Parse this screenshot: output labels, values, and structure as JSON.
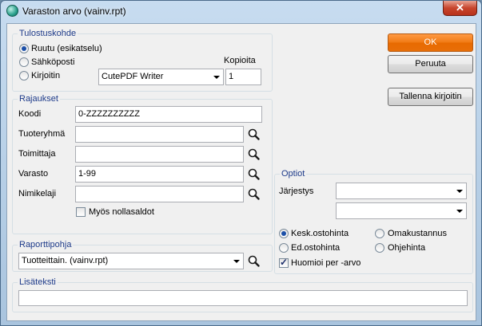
{
  "window": {
    "title": "Varaston arvo (vainv.rpt)",
    "close_label": "✕",
    "app_icon": "report-icon"
  },
  "tulostuskohde": {
    "title": "Tulostuskohde",
    "options": [
      {
        "label": "Ruutu (esikatselu)",
        "checked": true
      },
      {
        "label": "Sähköposti",
        "checked": false
      },
      {
        "label": "Kirjoitin",
        "checked": false
      }
    ],
    "printer": "CutePDF Writer",
    "copies_label": "Kopioita",
    "copies_value": "1"
  },
  "rajaukset": {
    "title": "Rajaukset",
    "fields": [
      {
        "label": "Koodi",
        "value": "0-ZZZZZZZZZZ"
      },
      {
        "label": "Tuoteryhmä",
        "value": ""
      },
      {
        "label": "Toimittaja",
        "value": ""
      },
      {
        "label": "Varasto",
        "value": "1-99"
      },
      {
        "label": "Nimikelaji",
        "value": ""
      }
    ],
    "checkbox_label": "Myös nollasaldot"
  },
  "raporttipohja": {
    "title": "Raporttipohja",
    "value": "Tuotteittain. (vainv.rpt)"
  },
  "lisateksti": {
    "title": "Lisäteksti",
    "value": ""
  },
  "optiot": {
    "title": "Optiot",
    "order_label": "Järjestys",
    "order_value_1": "",
    "order_value_2": "",
    "radios": {
      "kesk": "Kesk.ostohinta",
      "omak": "Omakustannus",
      "ed": "Ed.ostohinta",
      "ohje": "Ohjehinta"
    },
    "checkbox_label": "Huomioi per -arvo"
  },
  "buttons": {
    "ok": "OK",
    "cancel": "Peruuta",
    "save_printer": "Tallenna kirjoitin"
  },
  "colors": {
    "accent": "#ef7a12",
    "group_title": "#1e3b8a"
  }
}
